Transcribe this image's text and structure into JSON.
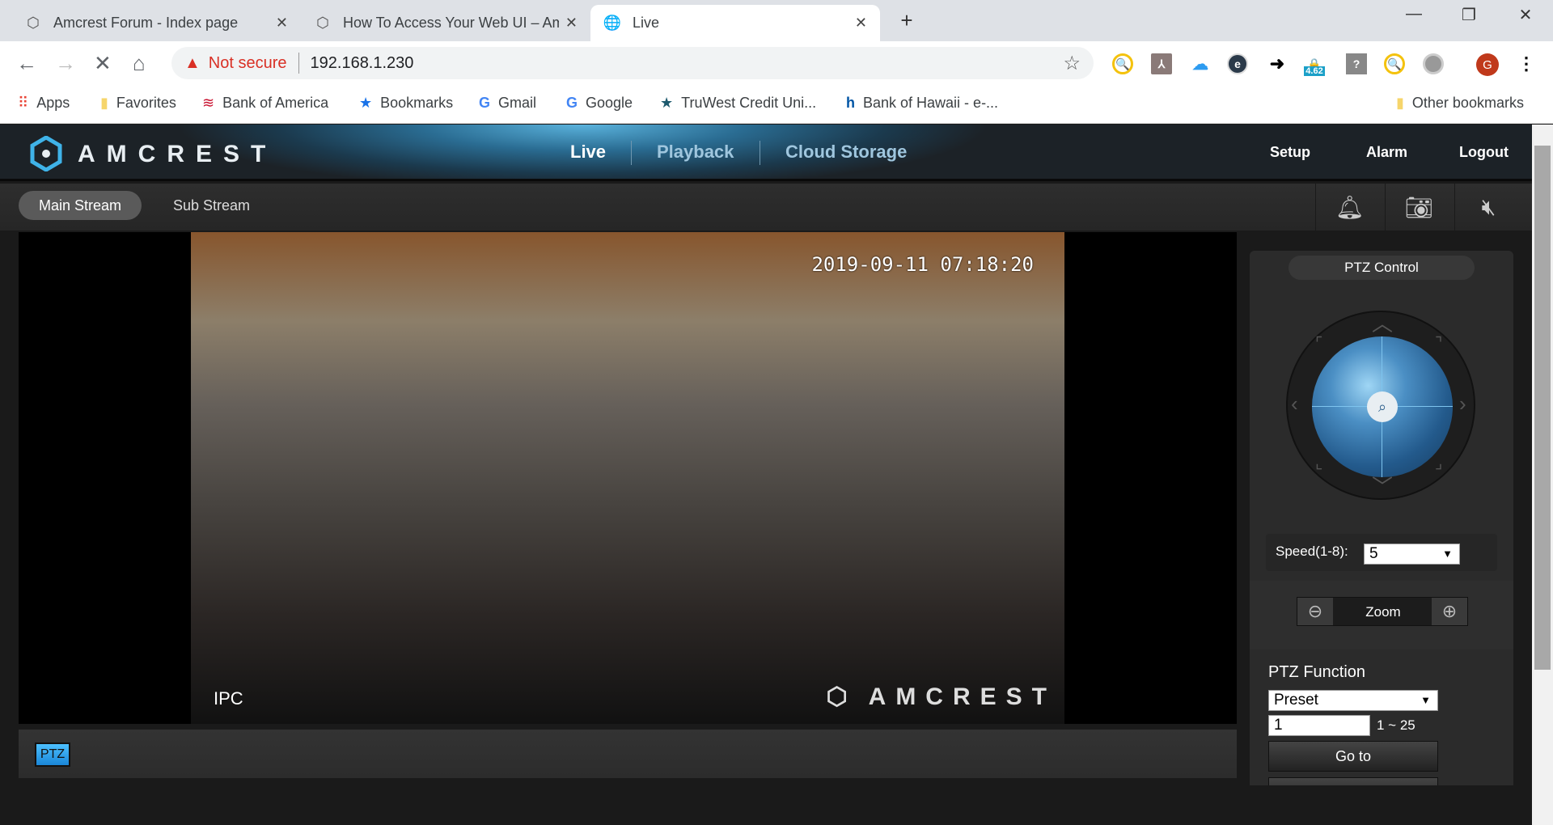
{
  "browser": {
    "tabs": [
      {
        "title": "Amcrest Forum - Index page",
        "icon": "amcrest-icon"
      },
      {
        "title": "How To Access Your Web UI – Amcrest",
        "icon": "amcrest-icon"
      },
      {
        "title": "Live",
        "icon": "globe-icon",
        "active": true
      }
    ],
    "address": {
      "security": "Not secure",
      "url": "192.168.1.230"
    },
    "extension_badge": "4.62",
    "profile_initial": "G",
    "bookmarks": [
      "Apps",
      "Favorites",
      "Bank of America",
      "Bookmarks",
      "Gmail",
      "Google",
      "TruWest Credit Uni...",
      "Bank of Hawaii - e-..."
    ],
    "other_bookmarks": "Other bookmarks"
  },
  "app": {
    "logo": "AMCREST",
    "nav": [
      "Live",
      "Playback",
      "Cloud Storage"
    ],
    "active_nav": "Live",
    "links": [
      "Setup",
      "Alarm",
      "Logout"
    ],
    "streams": [
      "Main Stream",
      "Sub Stream"
    ],
    "active_stream": "Main Stream",
    "video": {
      "timestamp": "2019-09-11 07:18:20",
      "channel_label": "IPC",
      "watermark": "AMCREST"
    },
    "ptz_toggle": "PTZ",
    "ptz": {
      "title": "PTZ Control",
      "speed_label": "Speed(1-8):",
      "speed_value": "5",
      "zoom_label": "Zoom",
      "function_title": "PTZ Function",
      "function_value": "Preset",
      "preset_value": "1",
      "preset_range": "1 ~ 25",
      "goto_label": "Go to"
    }
  },
  "colors": {
    "accent": "#1a86d8",
    "header": "#2a6c92",
    "warning": "#d93025"
  }
}
